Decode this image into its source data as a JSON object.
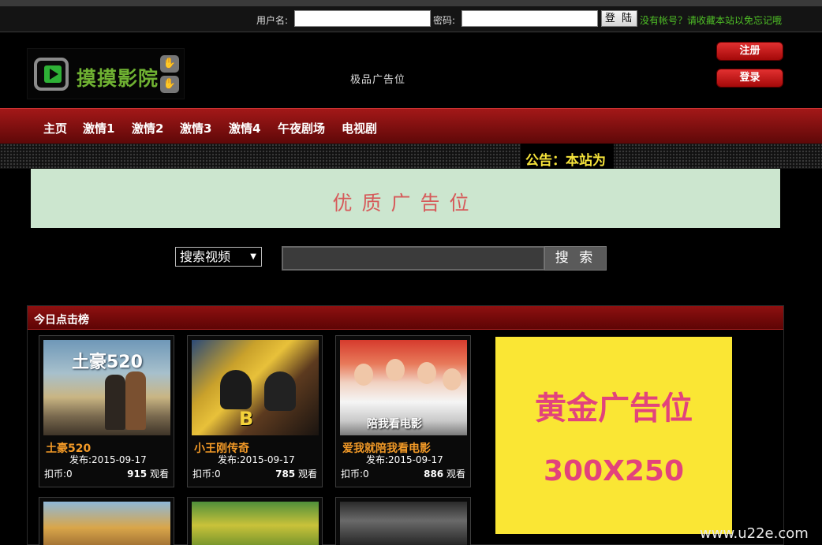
{
  "login": {
    "username_label": "用户名:",
    "password_label": "密码:",
    "username_value": "",
    "password_value": "",
    "submit_label": "登 陆",
    "hint": "没有帐号？请收藏本站以免忘记哦"
  },
  "header": {
    "logo_text": "摸摸影院",
    "ad_text": "极品广告位",
    "register_label": "注册",
    "login_label": "登录"
  },
  "nav": [
    "主页",
    "激情1",
    "激情2",
    "激情3",
    "激情4",
    "午夜剧场",
    "电视剧"
  ],
  "notice": "公告：本站为",
  "banner_ad": "优质广告位",
  "search": {
    "select_value": "搜索视频",
    "input_value": "",
    "button_label": "搜 索"
  },
  "ranking": {
    "heading": "今日点击榜",
    "items": [
      {
        "title": "土豪520",
        "date": "发布:2015-09-17",
        "coins": "扣币:0",
        "views_count": "915",
        "views_unit": "观看",
        "poster_text": "土豪520"
      },
      {
        "title": "小王刚传奇",
        "date": "发布:2015-09-17",
        "coins": "扣币:0",
        "views_count": "785",
        "views_unit": "观看",
        "poster_text": "B"
      },
      {
        "title": "爱我就陪我看电影",
        "date": "发布:2015-09-17",
        "coins": "扣币:0",
        "views_count": "886",
        "views_unit": "观看",
        "poster_text": "陪我看电影"
      }
    ]
  },
  "gold_ad": {
    "line1": "黄金广告位",
    "line2": "300X250"
  },
  "watermark": "www.u22e.com",
  "colors": {
    "nav_red": "#8e1010",
    "title_orange": "#f39a27",
    "hint_green": "#4fbf26",
    "notice_yellow": "#f4e23a",
    "gold_ad_bg": "#fae634",
    "gold_ad_text": "#e2437c"
  }
}
